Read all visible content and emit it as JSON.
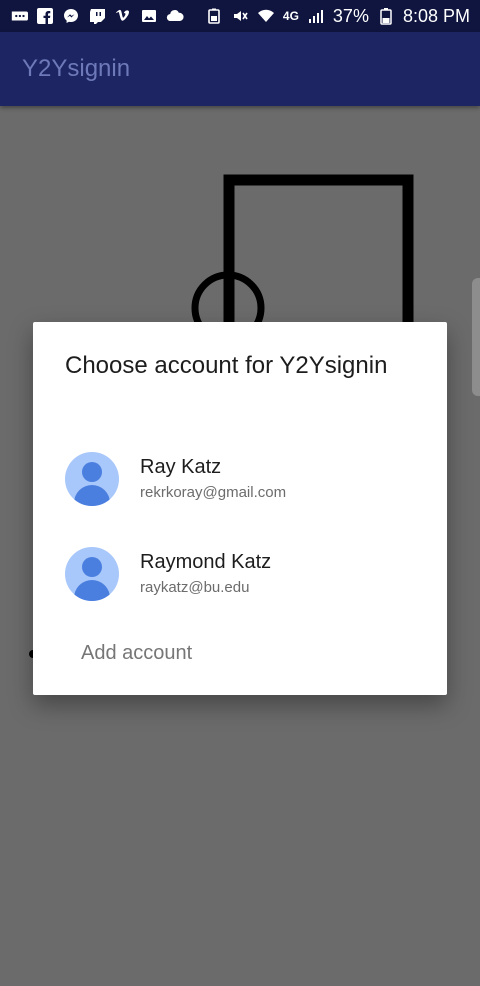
{
  "status_bar": {
    "icons": [
      "more-icon",
      "facebook-icon",
      "messenger-icon",
      "twitch-icon",
      "vimeo-icon",
      "gallery-icon",
      "cloud-icon"
    ],
    "right_icons": [
      "battery-saver-icon",
      "mute-icon",
      "wifi-icon",
      "4g-icon",
      "signal-icon"
    ],
    "network": "4G",
    "battery": "37%",
    "time": "8:08 PM"
  },
  "app_bar": {
    "title": "Y2Ysignin"
  },
  "dialog": {
    "title": "Choose account for Y2Ysignin",
    "accounts": [
      {
        "name": "Ray Katz",
        "email": "rekrkoray@gmail.com"
      },
      {
        "name": "Raymond Katz",
        "email": "raykatz@bu.edu"
      }
    ],
    "add_account": "Add account"
  },
  "colors": {
    "status_bar": "#0f153f",
    "app_bar": "#1d2563",
    "app_title": "#6e79b9",
    "scrim": "#6b6b6b",
    "avatar_bg": "#a8c7fa",
    "avatar_fg": "#4a7fe0"
  }
}
